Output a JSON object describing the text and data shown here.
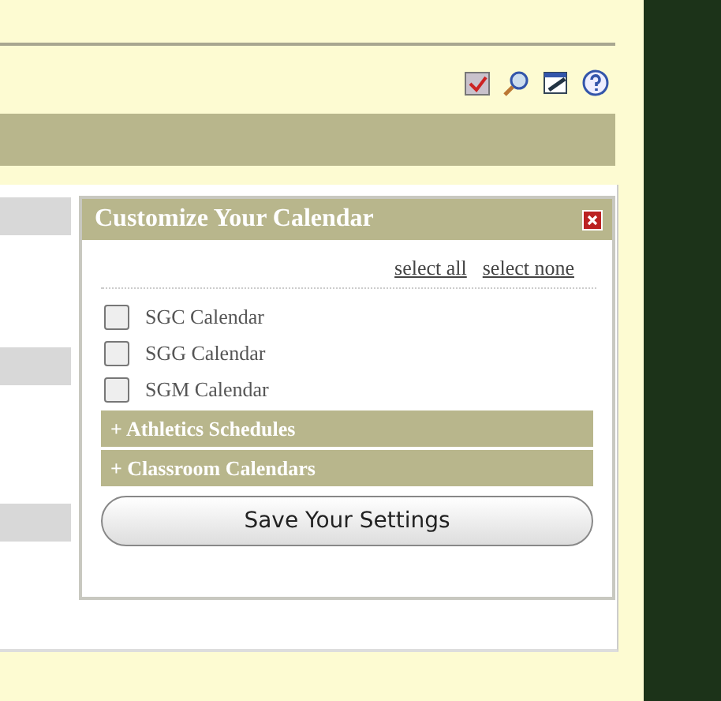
{
  "popup": {
    "title": "Customize Your Calendar",
    "links": [
      "select all",
      "select none"
    ],
    "calendars": [
      {
        "label": "SGC Calendar",
        "checked": false
      },
      {
        "label": "SGG Calendar",
        "checked": false
      },
      {
        "label": "SGM Calendar",
        "checked": false
      }
    ],
    "sections": [
      "+ Athletics Schedules",
      "+ Classroom Calendars"
    ],
    "save_button": "Save Your Settings"
  }
}
